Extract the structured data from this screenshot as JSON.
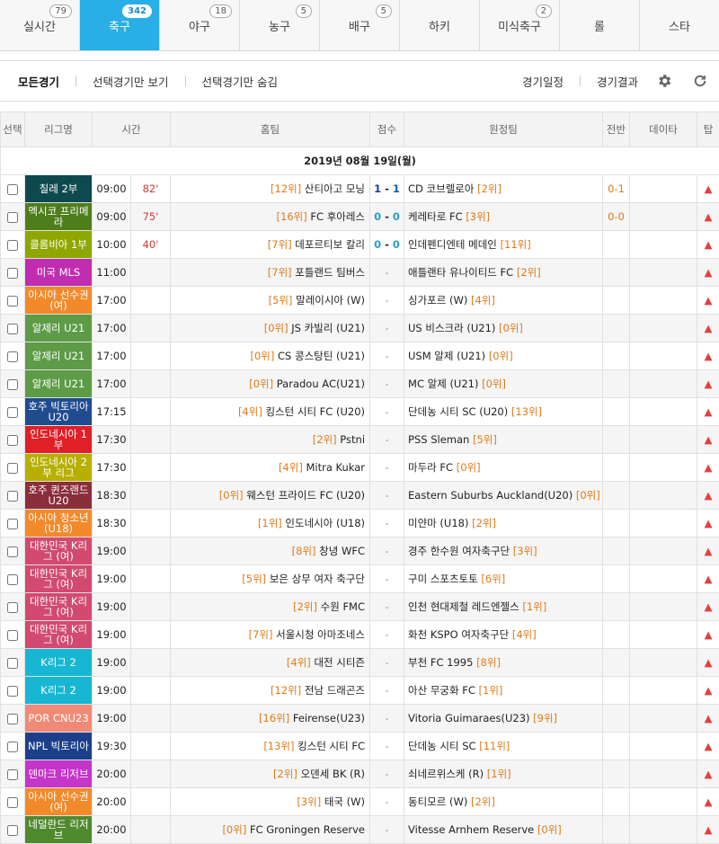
{
  "tabs": [
    {
      "label": "실시간",
      "badge": "79"
    },
    {
      "label": "축구",
      "badge": "342",
      "active": true
    },
    {
      "label": "야구",
      "badge": "18"
    },
    {
      "label": "농구",
      "badge": "5"
    },
    {
      "label": "배구",
      "badge": "5"
    },
    {
      "label": "하키",
      "badge": ""
    },
    {
      "label": "미식축구",
      "badge": "2"
    },
    {
      "label": "롤",
      "badge": ""
    },
    {
      "label": "스타",
      "badge": ""
    }
  ],
  "subbar": {
    "all": "모든경기",
    "show_selected": "선택경기만 보기",
    "hide_selected": "선택경기만 숨김",
    "schedule": "경기일정",
    "results": "경기결과",
    "settings_icon": "gear-icon",
    "refresh_icon": "refresh-icon"
  },
  "columns": {
    "select": "선택",
    "league": "리그명",
    "time": "시간",
    "home": "홈팀",
    "score": "점수",
    "away": "원정팀",
    "half": "전반",
    "data": "데이타",
    "tip": "탑"
  },
  "date": "2019년 08월 19일(월)",
  "colors": {
    "active_tab": "#29aee6",
    "rank": "#e07b1a",
    "minute": "#d63838",
    "tip_arrow": "#e53e3e"
  },
  "matches": [
    {
      "league": "칠레 2부",
      "lc": "#0d4a4f",
      "time": "09:00",
      "min": "82'",
      "hr": "[12위]",
      "ht": "산티아고 모닝",
      "sh": "1",
      "sa": "1",
      "at": "CD 코브렐로아",
      "ar": "[2위]",
      "half": "0-1",
      "live": true
    },
    {
      "league": "멕시코 프리메라",
      "lc": "#4e7d1b",
      "time": "09:00",
      "min": "75'",
      "hr": "[16위]",
      "ht": "FC 후아레스",
      "sh": "0",
      "sa": "0",
      "at": "케레타로 FC",
      "ar": "[3위]",
      "half": "0-0",
      "live": true
    },
    {
      "league": "콜롬비아 1부",
      "lc": "#8ea600",
      "time": "10:00",
      "min": "40'",
      "hr": "[7위]",
      "ht": "데포르티보 칼리",
      "sh": "0",
      "sa": "0",
      "at": "인데펜디엔테 메데인",
      "ar": "[11위]",
      "half": "",
      "live": true
    },
    {
      "league": "미국 MLS",
      "lc": "#c02db0",
      "time": "11:00",
      "min": "",
      "hr": "[7위]",
      "ht": "포틀랜드 팀버스",
      "at": "애틀랜타 유나이티드 FC",
      "ar": "[2위]",
      "half": ""
    },
    {
      "league": "아시아 선수권 (여)",
      "lc": "#f28a2c",
      "time": "17:00",
      "min": "",
      "hr": "[5위]",
      "ht": "말레이시아 (W)",
      "at": "싱가포르 (W)",
      "ar": "[4위]",
      "half": ""
    },
    {
      "league": "알제리 U21",
      "lc": "#5d9b47",
      "time": "17:00",
      "min": "",
      "hr": "[0위]",
      "ht": "JS 카빌리 (U21)",
      "at": "US 비스크라 (U21)",
      "ar": "[0위]",
      "half": ""
    },
    {
      "league": "알제리 U21",
      "lc": "#5d9b47",
      "time": "17:00",
      "min": "",
      "hr": "[0위]",
      "ht": "CS 콩스탕틴 (U21)",
      "at": "USM 알제 (U21)",
      "ar": "[0위]",
      "half": ""
    },
    {
      "league": "알제리 U21",
      "lc": "#5d9b47",
      "time": "17:00",
      "min": "",
      "hr": "[0위]",
      "ht": "Paradou AC(U21)",
      "at": "MC 알제 (U21)",
      "ar": "[0위]",
      "half": ""
    },
    {
      "league": "호주 빅토리아 U20",
      "lc": "#1f4c8f",
      "time": "17:15",
      "min": "",
      "hr": "[4위]",
      "ht": "킹스턴 시티 FC (U20)",
      "at": "단데농 시티 SC (U20)",
      "ar": "[13위]",
      "half": ""
    },
    {
      "league": "인도네시아 1부",
      "lc": "#e01f26",
      "time": "17:30",
      "min": "",
      "hr": "[2위]",
      "ht": "Pstni",
      "at": "PSS Sleman",
      "ar": "[5위]",
      "half": ""
    },
    {
      "league": "인도네시아 2부 리그",
      "lc": "#b7b000",
      "time": "17:30",
      "min": "",
      "hr": "[4위]",
      "ht": "Mitra Kukar",
      "at": "마두라 FC",
      "ar": "[0위]",
      "half": ""
    },
    {
      "league": "호주 퀸즈랜드 U20",
      "lc": "#8b2e3b",
      "time": "18:30",
      "min": "",
      "hr": "[0위]",
      "ht": "웨스턴 프라이드 FC (U20)",
      "at": "Eastern Suburbs Auckland(U20)",
      "ar": "[0위]",
      "half": ""
    },
    {
      "league": "아시아 청소년 (U18)",
      "lc": "#f28a2c",
      "time": "18:30",
      "min": "",
      "hr": "[1위]",
      "ht": "인도네시아 (U18)",
      "at": "미얀마 (U18)",
      "ar": "[2위]",
      "half": ""
    },
    {
      "league": "대한민국 K리그 (여)",
      "lc": "#d24a6f",
      "time": "19:00",
      "min": "",
      "hr": "[8위]",
      "ht": "창녕 WFC",
      "at": "경주 한수원 여자축구단",
      "ar": "[3위]",
      "half": ""
    },
    {
      "league": "대한민국 K리그 (여)",
      "lc": "#d24a6f",
      "time": "19:00",
      "min": "",
      "hr": "[5위]",
      "ht": "보은 상무 여자 축구단",
      "at": "구미 스포츠토토",
      "ar": "[6위]",
      "half": ""
    },
    {
      "league": "대한민국 K리그 (여)",
      "lc": "#d24a6f",
      "time": "19:00",
      "min": "",
      "hr": "[2위]",
      "ht": "수원 FMC",
      "at": "인천 현대제철 레드엔젤스",
      "ar": "[1위]",
      "half": ""
    },
    {
      "league": "대한민국 K리그 (여)",
      "lc": "#d24a6f",
      "time": "19:00",
      "min": "",
      "hr": "[7위]",
      "ht": "서울시청 아마조네스",
      "at": "화천 KSPO 여자축구단",
      "ar": "[4위]",
      "half": ""
    },
    {
      "league": "K리그 2",
      "lc": "#17b7d4",
      "time": "19:00",
      "min": "",
      "hr": "[4위]",
      "ht": "대전 시티즌",
      "at": "부천 FC 1995",
      "ar": "[8위]",
      "half": ""
    },
    {
      "league": "K리그 2",
      "lc": "#17b7d4",
      "time": "19:00",
      "min": "",
      "hr": "[12위]",
      "ht": "전남 드래곤즈",
      "at": "아산 무궁화 FC",
      "ar": "[1위]",
      "half": ""
    },
    {
      "league": "POR CNU23",
      "lc": "#f08a76",
      "time": "19:00",
      "min": "",
      "hr": "[16위]",
      "ht": "Feirense(U23)",
      "at": "Vitoria Guimaraes(U23)",
      "ar": "[9위]",
      "half": ""
    },
    {
      "league": "NPL 빅토리아",
      "lc": "#1d3f8a",
      "time": "19:30",
      "min": "",
      "hr": "[13위]",
      "ht": "킹스턴 시티 FC",
      "at": "단데농 시티 SC",
      "ar": "[11위]",
      "half": ""
    },
    {
      "league": "덴마크 리저브",
      "lc": "#c435c9",
      "time": "20:00",
      "min": "",
      "hr": "[2위]",
      "ht": "오덴세 BK (R)",
      "at": "쇠네르위스케 (R)",
      "ar": "[1위]",
      "half": ""
    },
    {
      "league": "아시아 선수권 (여)",
      "lc": "#f28a2c",
      "time": "20:00",
      "min": "",
      "hr": "[3위]",
      "ht": "태국 (W)",
      "at": "동티모르 (W)",
      "ar": "[2위]",
      "half": ""
    },
    {
      "league": "네덜란드 리저브",
      "lc": "#4f8a2e",
      "time": "20:00",
      "min": "",
      "hr": "[0위]",
      "ht": "FC Groningen Reserve",
      "at": "Vitesse Arnhem Reserve",
      "ar": "[0위]",
      "half": ""
    }
  ]
}
